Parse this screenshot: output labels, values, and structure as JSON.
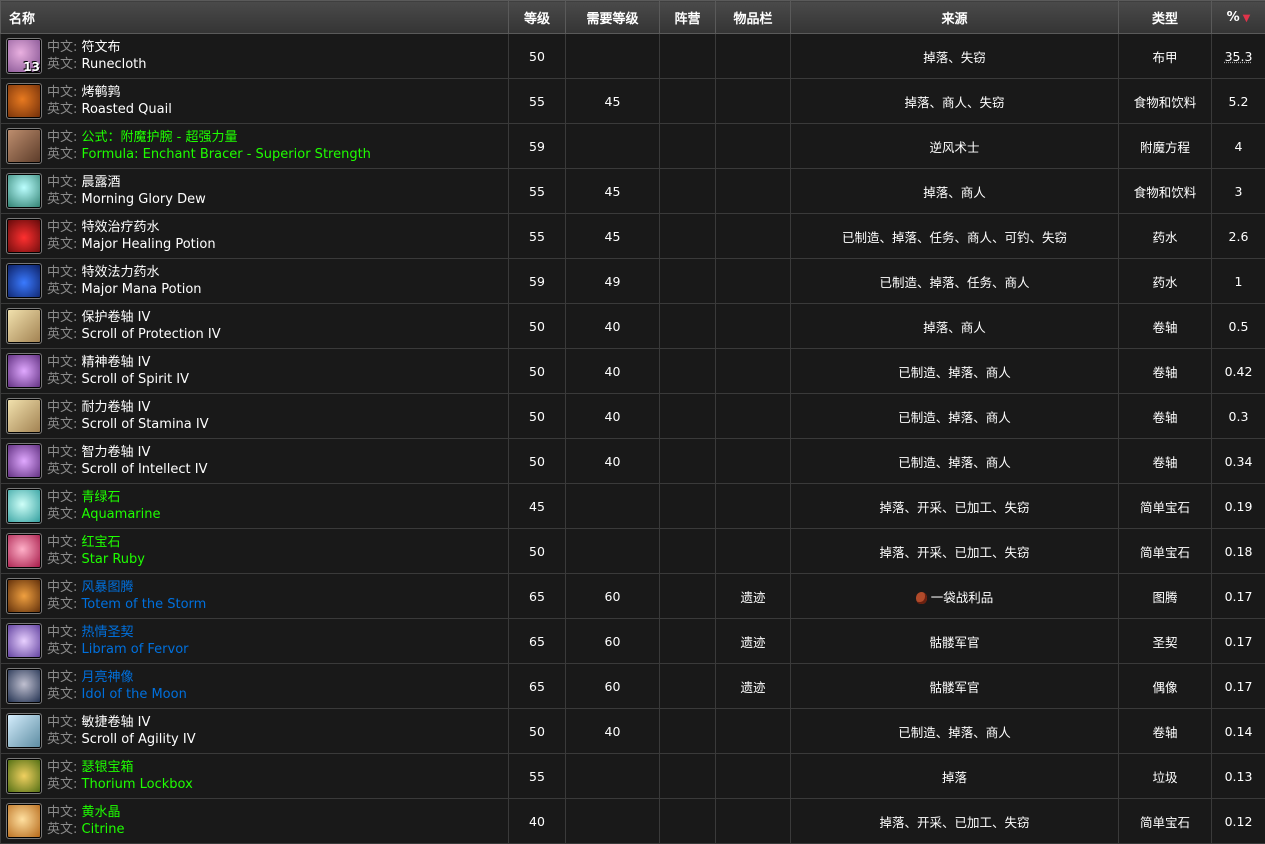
{
  "headers": {
    "name": "名称",
    "level": "等级",
    "req_level": "需要等级",
    "faction": "阵营",
    "slot": "物品栏",
    "source": "来源",
    "type": "类型",
    "pct": "%"
  },
  "label_cn": "中文:",
  "label_en": "英文:",
  "colors": {
    "white": "#ffffff",
    "green": "#1eff00",
    "blue": "#0070dd",
    "label": "#8a8a8a"
  },
  "rows": [
    {
      "cn": "符文布",
      "en": "Runecloth",
      "quality": "white",
      "icon": "runecloth-icon",
      "stack": "13",
      "level": "50",
      "req": "",
      "faction": "",
      "slot": "",
      "source": "掉落、失窃",
      "type": "布甲",
      "pct": "35.3"
    },
    {
      "cn": "烤鹌鹑",
      "en": "Roasted Quail",
      "quality": "white",
      "icon": "roasted-quail-icon",
      "stack": "",
      "level": "55",
      "req": "45",
      "faction": "",
      "slot": "",
      "source": "掉落、商人、失窃",
      "type": "食物和饮料",
      "pct": "5.2"
    },
    {
      "cn": "公式：附魔护腕 - 超强力量",
      "en": "Formula: Enchant Bracer - Superior Strength",
      "quality": "green",
      "icon": "formula-icon",
      "stack": "",
      "level": "59",
      "req": "",
      "faction": "",
      "slot": "",
      "source": "逆风术士",
      "type": "附魔方程",
      "pct": "4"
    },
    {
      "cn": "晨露酒",
      "en": "Morning Glory Dew",
      "quality": "white",
      "icon": "morning-glory-dew-icon",
      "stack": "",
      "level": "55",
      "req": "45",
      "faction": "",
      "slot": "",
      "source": "掉落、商人",
      "type": "食物和饮料",
      "pct": "3"
    },
    {
      "cn": "特效治疗药水",
      "en": "Major Healing Potion",
      "quality": "white",
      "icon": "healing-potion-icon",
      "stack": "",
      "level": "55",
      "req": "45",
      "faction": "",
      "slot": "",
      "source": "已制造、掉落、任务、商人、可钓、失窃",
      "type": "药水",
      "pct": "2.6"
    },
    {
      "cn": "特效法力药水",
      "en": "Major Mana Potion",
      "quality": "white",
      "icon": "mana-potion-icon",
      "stack": "",
      "level": "59",
      "req": "49",
      "faction": "",
      "slot": "",
      "source": "已制造、掉落、任务、商人",
      "type": "药水",
      "pct": "1"
    },
    {
      "cn": "保护卷轴 IV",
      "en": "Scroll of Protection IV",
      "quality": "white",
      "icon": "scroll-icon",
      "stack": "",
      "level": "50",
      "req": "40",
      "faction": "",
      "slot": "",
      "source": "掉落、商人",
      "type": "卷轴",
      "pct": "0.5"
    },
    {
      "cn": "精神卷轴 IV",
      "en": "Scroll of Spirit IV",
      "quality": "white",
      "icon": "purple-scroll-icon",
      "stack": "",
      "level": "50",
      "req": "40",
      "faction": "",
      "slot": "",
      "source": "已制造、掉落、商人",
      "type": "卷轴",
      "pct": "0.42"
    },
    {
      "cn": "耐力卷轴 IV",
      "en": "Scroll of Stamina IV",
      "quality": "white",
      "icon": "scroll-icon",
      "stack": "",
      "level": "50",
      "req": "40",
      "faction": "",
      "slot": "",
      "source": "已制造、掉落、商人",
      "type": "卷轴",
      "pct": "0.3"
    },
    {
      "cn": "智力卷轴 IV",
      "en": "Scroll of Intellect IV",
      "quality": "white",
      "icon": "purple-scroll-icon",
      "stack": "",
      "level": "50",
      "req": "40",
      "faction": "",
      "slot": "",
      "source": "已制造、掉落、商人",
      "type": "卷轴",
      "pct": "0.34"
    },
    {
      "cn": "青绿石",
      "en": "Aquamarine",
      "quality": "green",
      "icon": "aquamarine-gem-icon",
      "stack": "",
      "level": "45",
      "req": "",
      "faction": "",
      "slot": "",
      "source": "掉落、开采、已加工、失窃",
      "type": "简单宝石",
      "pct": "0.19"
    },
    {
      "cn": "红宝石",
      "en": "Star Ruby",
      "quality": "green",
      "icon": "ruby-gem-icon",
      "stack": "",
      "level": "50",
      "req": "",
      "faction": "",
      "slot": "",
      "source": "掉落、开采、已加工、失窃",
      "type": "简单宝石",
      "pct": "0.18"
    },
    {
      "cn": "风暴图腾",
      "en": "Totem of the Storm",
      "quality": "blue",
      "icon": "totem-icon",
      "stack": "",
      "level": "65",
      "req": "60",
      "faction": "",
      "slot": "遗迹",
      "source": "一袋战利品",
      "source_icon": "loot-bag-icon",
      "type": "图腾",
      "pct": "0.17"
    },
    {
      "cn": "热情圣契",
      "en": "Libram of Fervor",
      "quality": "blue",
      "icon": "libram-icon",
      "stack": "",
      "level": "65",
      "req": "60",
      "faction": "",
      "slot": "遗迹",
      "source": "骷髅军官",
      "type": "圣契",
      "pct": "0.17"
    },
    {
      "cn": "月亮神像",
      "en": "Idol of the Moon",
      "quality": "blue",
      "icon": "idol-icon",
      "stack": "",
      "level": "65",
      "req": "60",
      "faction": "",
      "slot": "遗迹",
      "source": "骷髅军官",
      "type": "偶像",
      "pct": "0.17"
    },
    {
      "cn": "敏捷卷轴 IV",
      "en": "Scroll of Agility IV",
      "quality": "white",
      "icon": "blue-scroll-icon",
      "stack": "",
      "level": "50",
      "req": "40",
      "faction": "",
      "slot": "",
      "source": "已制造、掉落、商人",
      "type": "卷轴",
      "pct": "0.14"
    },
    {
      "cn": "瑟银宝箱",
      "en": "Thorium Lockbox",
      "quality": "green",
      "icon": "lockbox-icon",
      "stack": "",
      "level": "55",
      "req": "",
      "faction": "",
      "slot": "",
      "source": "掉落",
      "type": "垃圾",
      "pct": "0.13"
    },
    {
      "cn": "黄水晶",
      "en": "Citrine",
      "quality": "green",
      "icon": "citrine-gem-icon",
      "stack": "",
      "level": "40",
      "req": "",
      "faction": "",
      "slot": "",
      "source": "掉落、开采、已加工、失窃",
      "type": "简单宝石",
      "pct": "0.12"
    }
  ]
}
